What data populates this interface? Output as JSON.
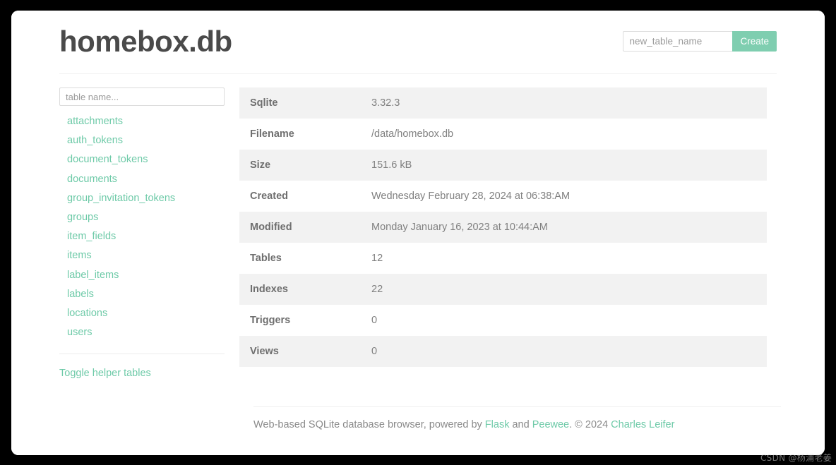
{
  "page_title": "homebox.db",
  "create_form": {
    "placeholder": "new_table_name",
    "value": "",
    "button_label": "Create"
  },
  "sidebar": {
    "filter_placeholder": "table name...",
    "tables": [
      "attachments",
      "auth_tokens",
      "document_tokens",
      "documents",
      "group_invitation_tokens",
      "groups",
      "item_fields",
      "items",
      "label_items",
      "labels",
      "locations",
      "users"
    ],
    "toggle_helper_label": "Toggle helper tables"
  },
  "info_table": {
    "rows": [
      {
        "key": "Sqlite",
        "value": "3.32.3"
      },
      {
        "key": "Filename",
        "value": "/data/homebox.db"
      },
      {
        "key": "Size",
        "value": "151.6 kB"
      },
      {
        "key": "Created",
        "value": "Wednesday February 28, 2024 at 06:38:AM"
      },
      {
        "key": "Modified",
        "value": "Monday January 16, 2023 at 10:44:AM"
      },
      {
        "key": "Tables",
        "value": "12"
      },
      {
        "key": "Indexes",
        "value": "22"
      },
      {
        "key": "Triggers",
        "value": "0"
      },
      {
        "key": "Views",
        "value": "0"
      }
    ]
  },
  "footer": {
    "text_1": "Web-based SQLite database browser, powered by ",
    "link_flask": "Flask",
    "text_2": " and ",
    "link_peewee": "Peewee",
    "text_3": ". © 2024 ",
    "link_author": "Charles Leifer"
  },
  "watermark": "CSDN @杨浦老姜",
  "colors": {
    "accent_green": "#6ecaa8",
    "button_green": "#7fceb0",
    "row_stripe": "#f2f2f2",
    "text_gray": "#7b7b7b",
    "title_gray": "#4a4a4a"
  }
}
